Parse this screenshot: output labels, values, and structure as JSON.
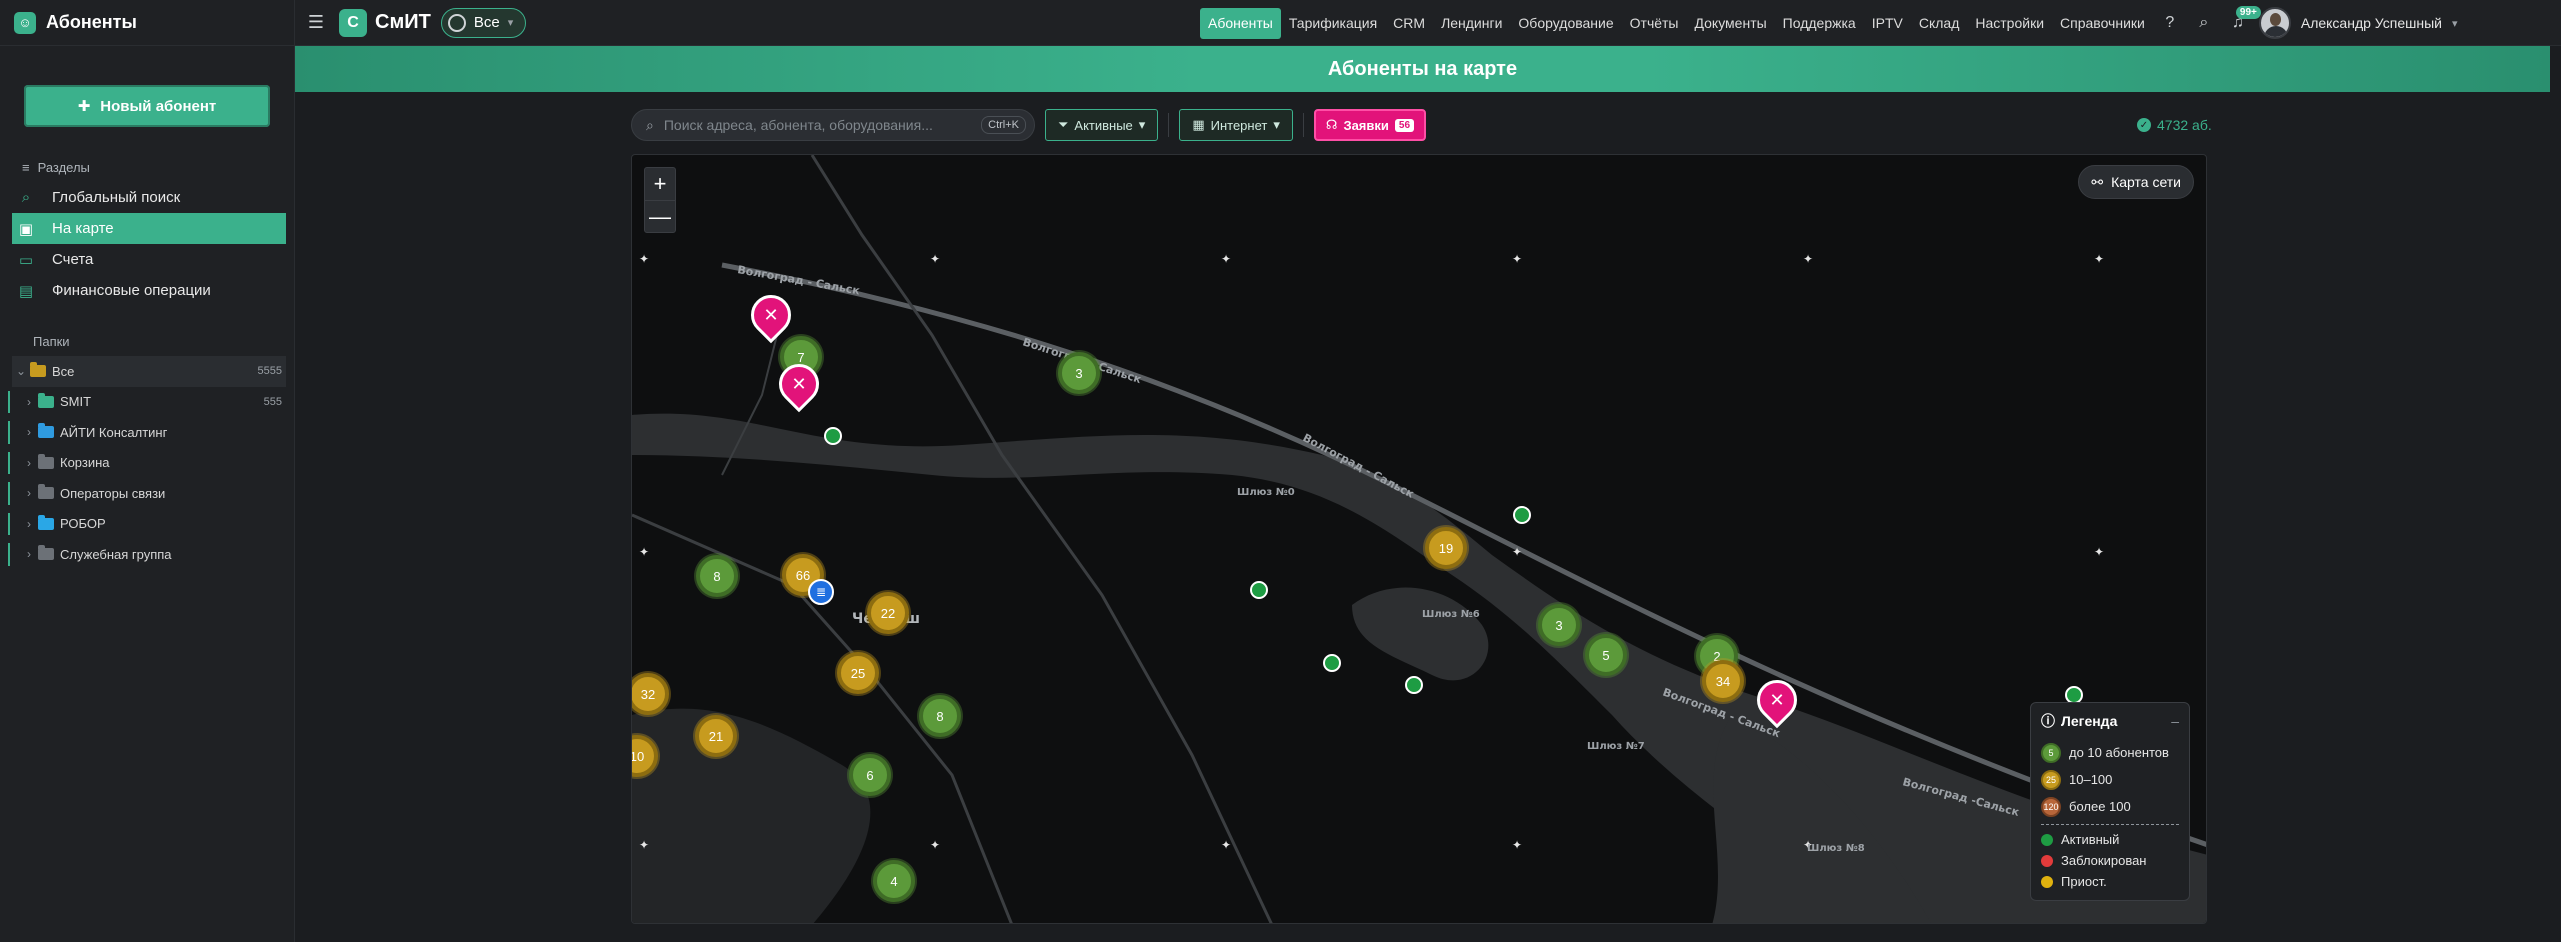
{
  "sidebar": {
    "title": "Абоненты",
    "new_button": "Новый абонент",
    "sections_label": "Разделы",
    "items": [
      {
        "label": "Глобальный поиск",
        "icon": "search-icon"
      },
      {
        "label": "На карте",
        "icon": "map-icon",
        "active": true
      },
      {
        "label": "Счета",
        "icon": "card-icon"
      },
      {
        "label": "Финансовые операции",
        "icon": "ledger-icon"
      }
    ],
    "folders_label": "Папки",
    "folders": [
      {
        "label": "Все",
        "count": "5555",
        "color": "#c79b1f"
      },
      {
        "label": "SMIT",
        "count": "555",
        "color": "#3bb18c"
      },
      {
        "label": "АЙТИ Консалтинг",
        "count": "",
        "color": "#2f9be0"
      },
      {
        "label": "Корзина",
        "count": "",
        "color": "#6c7177"
      },
      {
        "label": "Операторы связи",
        "count": "",
        "color": "#6c7177"
      },
      {
        "label": "РОБОР",
        "count": "",
        "color": "#2aa7e6"
      },
      {
        "label": "Служебная группа",
        "count": "",
        "color": "#6c7177"
      }
    ]
  },
  "topbar": {
    "brand_logo": "С",
    "brand": "СмИТ",
    "scope": "Все",
    "menu": [
      {
        "label": "Абоненты",
        "active": true
      },
      {
        "label": "Тарификация"
      },
      {
        "label": "CRM"
      },
      {
        "label": "Лендинги"
      },
      {
        "label": "Оборудование"
      },
      {
        "label": "Отчёты"
      },
      {
        "label": "Документы"
      },
      {
        "label": "Поддержка"
      },
      {
        "label": "IPTV"
      },
      {
        "label": "Склад"
      },
      {
        "label": "Настройки"
      },
      {
        "label": "Справочники"
      }
    ],
    "notifications_badge": "99+",
    "user_name": "Александр Успешный"
  },
  "content": {
    "banner": "Абоненты на карте",
    "search_placeholder": "Поиск адреса, абонента, оборудования...",
    "search_shortcut": "Ctrl+K",
    "filter_status": "Активные",
    "filter_service": "Интернет",
    "tickets_label": "Заявки",
    "tickets_count": "56",
    "subscriber_count": "4732 аб."
  },
  "map": {
    "net_map_label": "Карта сети",
    "zoom_in": "+",
    "zoom_out": "—",
    "road_labels": [
      "Волгоград - Сальск",
      "Волгоград - Сальск",
      "Волгоград - Сальск",
      "Волгоград - Сальск",
      "Волгоград -Сальск",
      "Шлюз №0",
      "Шлюз №6",
      "Шлюз №7",
      "Шлюз №8",
      "Черныш"
    ],
    "clusters": [
      {
        "n": "3",
        "type": "green"
      },
      {
        "n": "7",
        "type": "green"
      },
      {
        "n": "8",
        "type": "green"
      },
      {
        "n": "66",
        "type": "gold"
      },
      {
        "n": "22",
        "type": "gold"
      },
      {
        "n": "25",
        "type": "gold"
      },
      {
        "n": "32",
        "type": "gold"
      },
      {
        "n": "21",
        "type": "gold"
      },
      {
        "n": "10",
        "type": "gold"
      },
      {
        "n": "8",
        "type": "green"
      },
      {
        "n": "6",
        "type": "green"
      },
      {
        "n": "4",
        "type": "green"
      },
      {
        "n": "19",
        "type": "gold"
      },
      {
        "n": "3",
        "type": "green"
      },
      {
        "n": "5",
        "type": "green"
      },
      {
        "n": "2",
        "type": "green"
      },
      {
        "n": "34",
        "type": "gold"
      }
    ],
    "legend": {
      "title": "Легенда",
      "sizes": [
        {
          "sample": "5",
          "label": "до 10 абонентов",
          "color": "#5c9a3a"
        },
        {
          "sample": "25",
          "label": "10–100",
          "color": "#c79b1f"
        },
        {
          "sample": "120",
          "label": "более 100",
          "color": "#b8663a"
        }
      ],
      "statuses": [
        {
          "label": "Активный",
          "color": "#1e9c43"
        },
        {
          "label": "Заблокирован",
          "color": "#e23b3b"
        },
        {
          "label": "Приост.",
          "color": "#e0b20f"
        }
      ]
    }
  }
}
